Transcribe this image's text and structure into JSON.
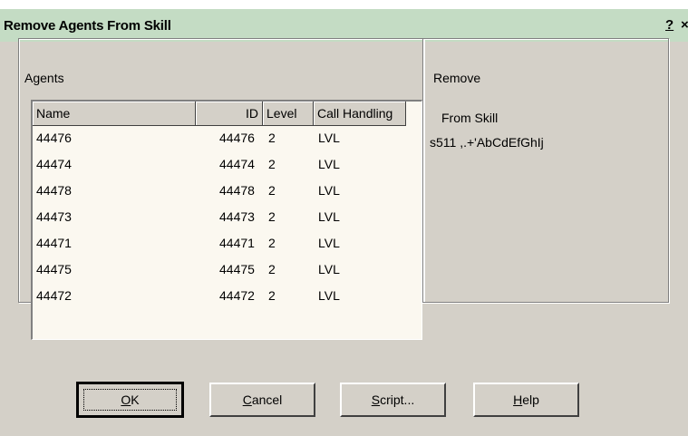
{
  "window": {
    "title": "Remove Agents From Skill",
    "help_glyph": "?",
    "close_glyph": "×"
  },
  "agents_group": {
    "label": "Agents",
    "columns": [
      "Name",
      "ID",
      "Level",
      "Call Handling"
    ],
    "rows": [
      {
        "name": "44476",
        "id": "44476",
        "level": "2",
        "call_handling": "LVL"
      },
      {
        "name": "44474",
        "id": "44474",
        "level": "2",
        "call_handling": "LVL"
      },
      {
        "name": "44478",
        "id": "44478",
        "level": "2",
        "call_handling": "LVL"
      },
      {
        "name": "44473",
        "id": "44473",
        "level": "2",
        "call_handling": "LVL"
      },
      {
        "name": "44471",
        "id": "44471",
        "level": "2",
        "call_handling": "LVL"
      },
      {
        "name": "44475",
        "id": "44475",
        "level": "2",
        "call_handling": "LVL"
      },
      {
        "name": "44472",
        "id": "44472",
        "level": "2",
        "call_handling": "LVL"
      }
    ]
  },
  "remove_group": {
    "label": "Remove",
    "from_skill_label": "From Skill",
    "skill_name": "s511 ,.+'AbCdEfGhIj"
  },
  "buttons": {
    "ok": {
      "mnemonic": "O",
      "rest": "K"
    },
    "cancel": {
      "mnemonic": "C",
      "rest": "ancel"
    },
    "script": {
      "mnemonic": "S",
      "rest": "cript..."
    },
    "help": {
      "mnemonic": "H",
      "rest": "elp"
    }
  }
}
